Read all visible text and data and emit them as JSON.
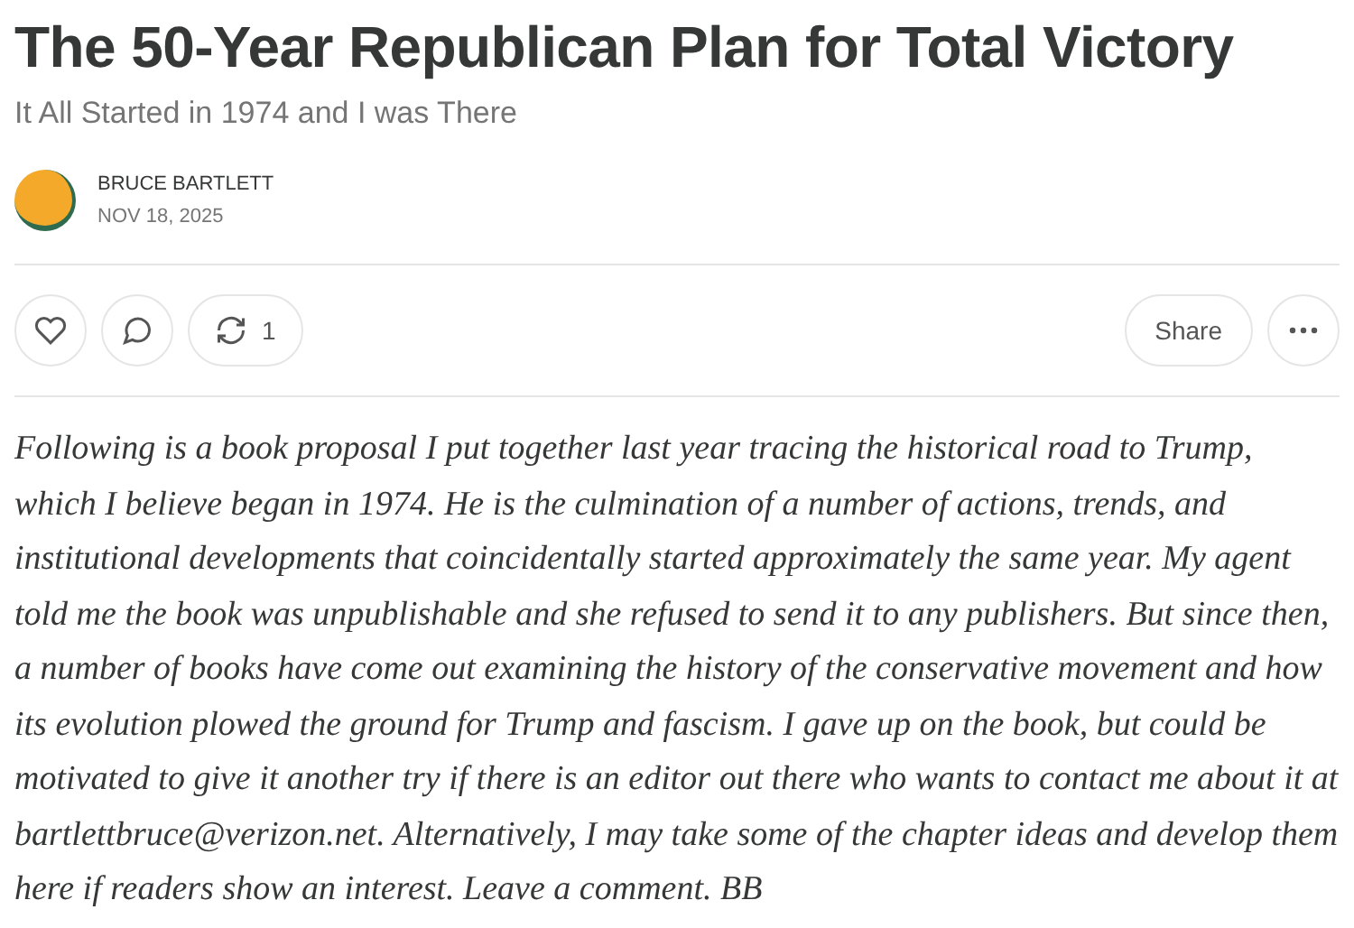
{
  "post": {
    "title": "The 50-Year Republican Plan for Total Victory",
    "subtitle": "It All Started in 1974 and I was There",
    "author": "BRUCE BARTLETT",
    "date": "NOV 18, 2025"
  },
  "actions": {
    "like": {
      "selected": false
    },
    "restack_count": "1",
    "share": "Share"
  },
  "body": "Following is a book proposal I put together last year tracing the historical road to Trump, which I believe began in 1974. He is the culmination of a number of actions, trends, and institutional developments that coincidentally started approximately the same year. My agent told me the book was unpublishable and she refused to send it to any publishers. But since then, a number of books have come out examining the history of the conservative movement and how its evolution plowed the ground for Trump and fascism. I gave up on the book, but could be motivated to give it another try if there is an editor out there who wants to contact me about it at bartlettbruce@verizon.net. Alternatively, I may take some of the chapter ideas and develop them here if readers show an interest. Leave a comment. BB"
}
